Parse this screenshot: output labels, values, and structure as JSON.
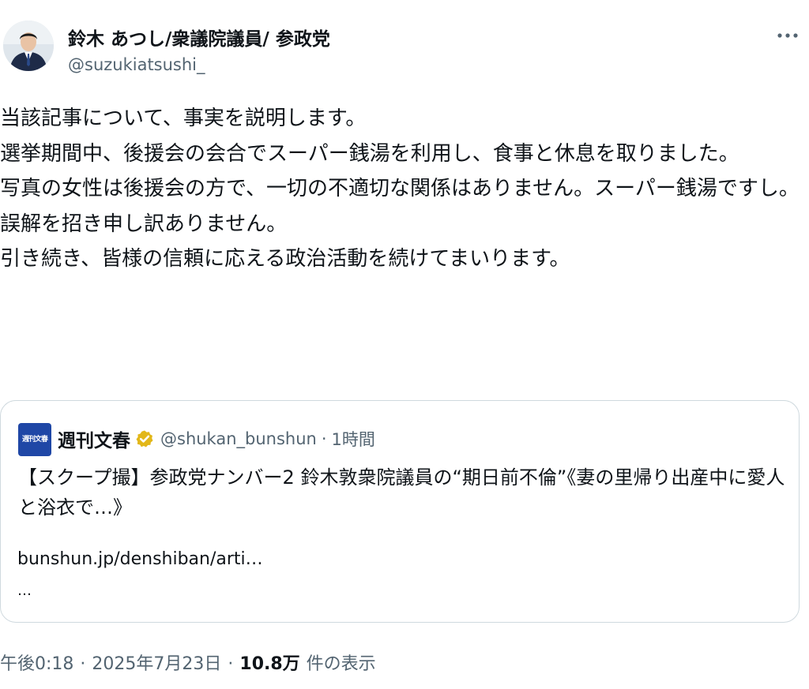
{
  "author": {
    "name": "鈴木 あつし/衆議院議員/ 参政党",
    "handle": "@suzukiatsushi_"
  },
  "more_label": "···",
  "tweet_lines": [
    "当該記事について、事実を説明します。",
    "",
    "選挙期間中、後援会の会合でスーパー銭湯を利用し、食事と休息を取りました。",
    "写真の女性は後援会の方で、一切の不適切な関係はありません。スーパー銭湯ですし。",
    "誤解を招き申し訳ありません。",
    "引き続き、皆様の信頼に応える政治活動を続けてまいります。"
  ],
  "quoted": {
    "logo_text": "週刊文春",
    "name": "週刊文春",
    "handle": "@shukan_bunshun",
    "separator": "·",
    "time": "1時間",
    "text": "【スクープ撮】参政党ナンバー2 鈴木敦衆院議員の“期日前不倫”《妻の里帰り出産中に愛人と浴衣で…》",
    "link": "bunshun.jp/denshiban/arti…",
    "ellipsis": "…",
    "verified_color": "#e2b719"
  },
  "meta": {
    "time": "午後0:18",
    "separator": "·",
    "date": "2025年7月23日",
    "views_count": "10.8万",
    "views_label": "件の表示"
  }
}
